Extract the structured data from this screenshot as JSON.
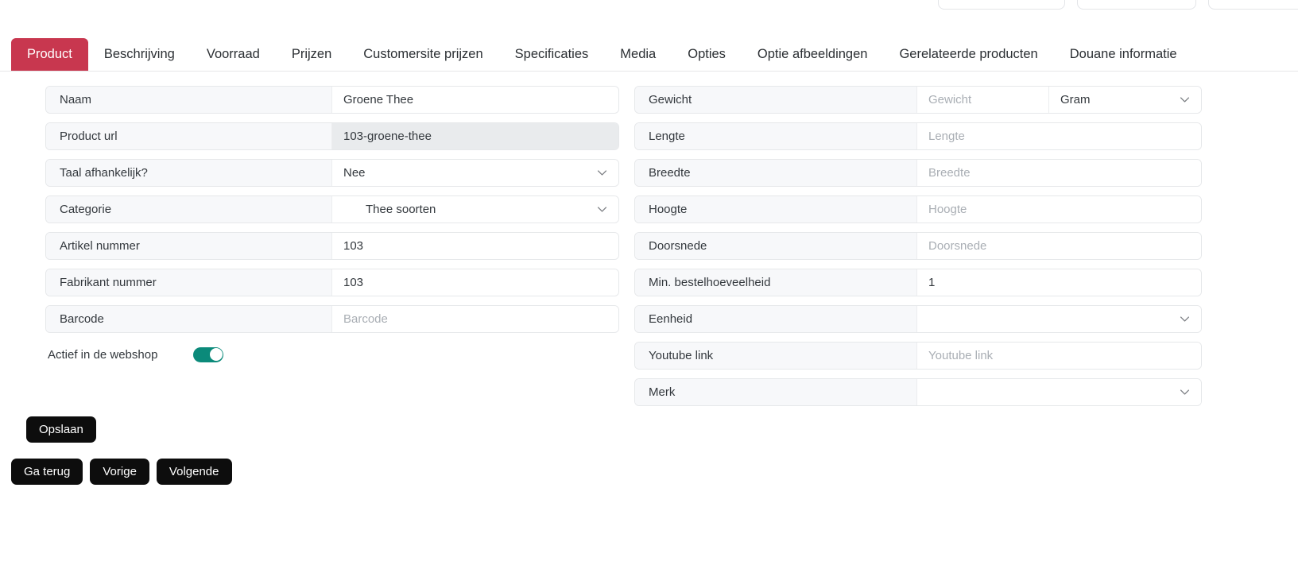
{
  "top_cards": [
    {
      "name": "top-card-1"
    },
    {
      "name": "top-card-2"
    },
    {
      "name": "top-card-3"
    }
  ],
  "tabs": [
    {
      "label": "Product",
      "active": true
    },
    {
      "label": "Beschrijving",
      "active": false
    },
    {
      "label": "Voorraad",
      "active": false
    },
    {
      "label": "Prijzen",
      "active": false
    },
    {
      "label": "Customersite prijzen",
      "active": false
    },
    {
      "label": "Specificaties",
      "active": false
    },
    {
      "label": "Media",
      "active": false
    },
    {
      "label": "Opties",
      "active": false
    },
    {
      "label": "Optie afbeeldingen",
      "active": false
    },
    {
      "label": "Gerelateerde producten",
      "active": false
    },
    {
      "label": "Douane informatie",
      "active": false
    }
  ],
  "left_fields": [
    {
      "label": "Naam",
      "value": "Groene Thee",
      "placeholder": "",
      "type": "text",
      "readonly": false
    },
    {
      "label": "Product url",
      "value": "103-groene-thee",
      "placeholder": "",
      "type": "text",
      "readonly": true
    },
    {
      "label": "Taal afhankelijk?",
      "value": "Nee",
      "placeholder": "",
      "type": "select",
      "readonly": false
    },
    {
      "label": "Categorie",
      "value": "Thee soorten",
      "placeholder": "",
      "type": "select",
      "readonly": false,
      "indent": true
    },
    {
      "label": "Artikel nummer",
      "value": "103",
      "placeholder": "",
      "type": "text",
      "readonly": false
    },
    {
      "label": "Fabrikant nummer",
      "value": "103",
      "placeholder": "",
      "type": "text",
      "readonly": false
    },
    {
      "label": "Barcode",
      "value": "",
      "placeholder": "Barcode",
      "type": "text",
      "readonly": false
    }
  ],
  "toggle": {
    "label": "Actief in de webshop",
    "on": true,
    "color": "#0b8a7a"
  },
  "right_fields": [
    {
      "label": "Gewicht",
      "value": "",
      "placeholder": "Gewicht",
      "type": "text",
      "unit": "Gram"
    },
    {
      "label": "Lengte",
      "value": "",
      "placeholder": "Lengte",
      "type": "text"
    },
    {
      "label": "Breedte",
      "value": "",
      "placeholder": "Breedte",
      "type": "text"
    },
    {
      "label": "Hoogte",
      "value": "",
      "placeholder": "Hoogte",
      "type": "text"
    },
    {
      "label": "Doorsnede",
      "value": "",
      "placeholder": "Doorsnede",
      "type": "text"
    },
    {
      "label": "Min. bestelhoeveelheid",
      "value": "1",
      "placeholder": "",
      "type": "text"
    },
    {
      "label": "Eenheid",
      "value": "",
      "placeholder": "",
      "type": "select"
    },
    {
      "label": "Youtube link",
      "value": "",
      "placeholder": "Youtube link",
      "type": "text"
    },
    {
      "label": "Merk",
      "value": "",
      "placeholder": "",
      "type": "select"
    }
  ],
  "buttons": {
    "save": "Opslaan",
    "back": "Ga terug",
    "previous": "Vorige",
    "next": "Volgende"
  },
  "colors": {
    "active_tab": "#c8374f",
    "button": "#0d0d0d",
    "toggle_on": "#0b8a7a"
  }
}
